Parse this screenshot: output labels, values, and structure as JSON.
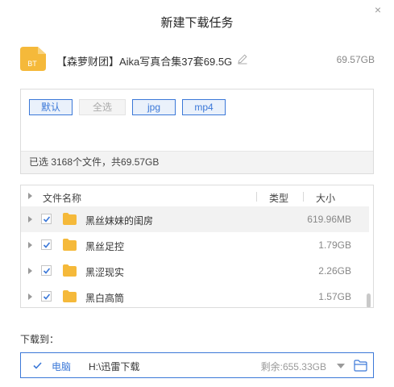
{
  "dialog": {
    "title": "新建下载任务",
    "close_glyph": "×"
  },
  "task": {
    "file_badge": "BT",
    "name": "【森萝财团】Aika写真合集37套69.5G",
    "size": "69.57GB"
  },
  "filters": [
    {
      "label": "默认",
      "active": true
    },
    {
      "label": "全选",
      "active": false
    },
    {
      "label": "jpg",
      "active": true
    },
    {
      "label": "mp4",
      "active": true
    }
  ],
  "summary": "已选 3168个文件，共69.57GB",
  "list": {
    "headers": {
      "name": "文件名称",
      "type": "类型",
      "size": "大小"
    },
    "rows": [
      {
        "name": "黑丝妹妹的闺房",
        "size": "619.96MB",
        "checked": true
      },
      {
        "name": "黑丝足控",
        "size": "1.79GB",
        "checked": true
      },
      {
        "name": "黑涩现实",
        "size": "2.26GB",
        "checked": true
      },
      {
        "name": "黑白高筒",
        "size": "1.57GB",
        "checked": true
      }
    ]
  },
  "download": {
    "label": "下载到：",
    "location": "电脑",
    "path": "H:\\迅雷下载",
    "remaining": "剩余:655.33GB"
  },
  "colors": {
    "accent": "#3b78d8",
    "folder": "#f5b93a"
  }
}
